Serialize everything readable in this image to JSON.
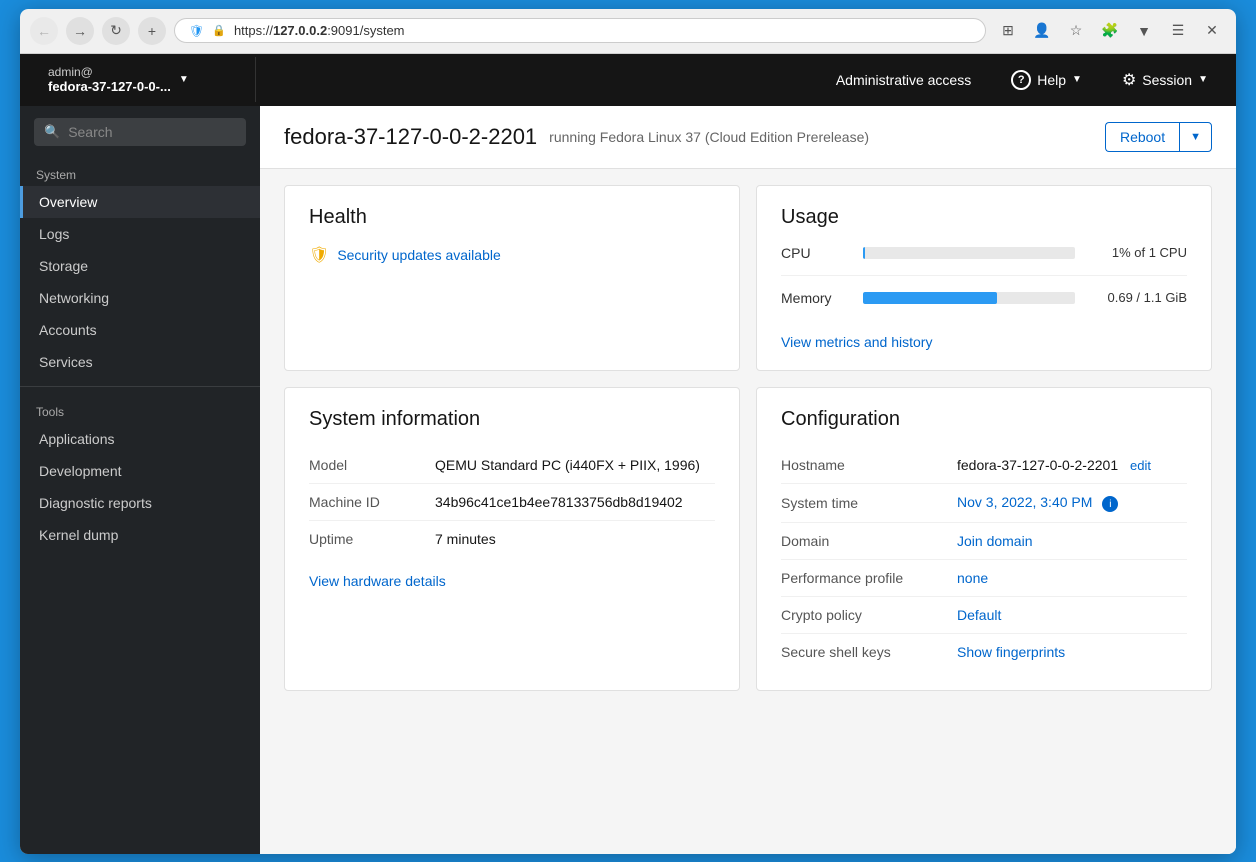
{
  "browser": {
    "url": "https://127.0.0.2:9091/system",
    "url_bold": "127.0.0.2",
    "url_rest": ":9091/system"
  },
  "header": {
    "user": "admin@",
    "hostname": "fedora-37-127-0-0-...",
    "admin_access": "Administrative access",
    "help": "Help",
    "session": "Session"
  },
  "sidebar": {
    "search_placeholder": "Search",
    "section_system": "System",
    "items": [
      {
        "id": "overview",
        "label": "Overview",
        "active": true
      },
      {
        "id": "logs",
        "label": "Logs",
        "active": false
      },
      {
        "id": "storage",
        "label": "Storage",
        "active": false
      },
      {
        "id": "networking",
        "label": "Networking",
        "active": false
      },
      {
        "id": "accounts",
        "label": "Accounts",
        "active": false
      },
      {
        "id": "services",
        "label": "Services",
        "active": false
      }
    ],
    "section_tools": "Tools",
    "tools": [
      {
        "id": "applications",
        "label": "Applications"
      },
      {
        "id": "development",
        "label": "Development"
      },
      {
        "id": "diagnostic-reports",
        "label": "Diagnostic reports"
      },
      {
        "id": "kernel-dump",
        "label": "Kernel dump"
      }
    ]
  },
  "page": {
    "title": "fedora-37-127-0-0-2-2201",
    "subtitle": "running Fedora Linux 37 (Cloud Edition Prerelease)",
    "reboot_btn": "Reboot"
  },
  "health": {
    "title": "Health",
    "alert_text": "Security updates available"
  },
  "usage": {
    "title": "Usage",
    "cpu_label": "CPU",
    "cpu_value": "1% of 1 CPU",
    "cpu_percent": 1,
    "memory_label": "Memory",
    "memory_value": "0.69 / 1.1 GiB",
    "memory_percent": 63,
    "view_metrics_link": "View metrics and history"
  },
  "system_info": {
    "title": "System information",
    "model_label": "Model",
    "model_value": "QEMU Standard PC (i440FX + PIIX, 1996)",
    "machine_id_label": "Machine ID",
    "machine_id_value": "34b96c41ce1b4ee78133756db8d19402",
    "uptime_label": "Uptime",
    "uptime_value": "7 minutes",
    "view_hardware_link": "View hardware details"
  },
  "configuration": {
    "title": "Configuration",
    "hostname_label": "Hostname",
    "hostname_value": "fedora-37-127-0-0-2-2201",
    "hostname_edit": "edit",
    "system_time_label": "System time",
    "system_time_value": "Nov 3, 2022, 3:40 PM",
    "domain_label": "Domain",
    "domain_link": "Join domain",
    "performance_label": "Performance profile",
    "performance_link": "none",
    "crypto_label": "Crypto policy",
    "crypto_link": "Default",
    "ssh_label": "Secure shell keys",
    "ssh_link": "Show fingerprints"
  }
}
